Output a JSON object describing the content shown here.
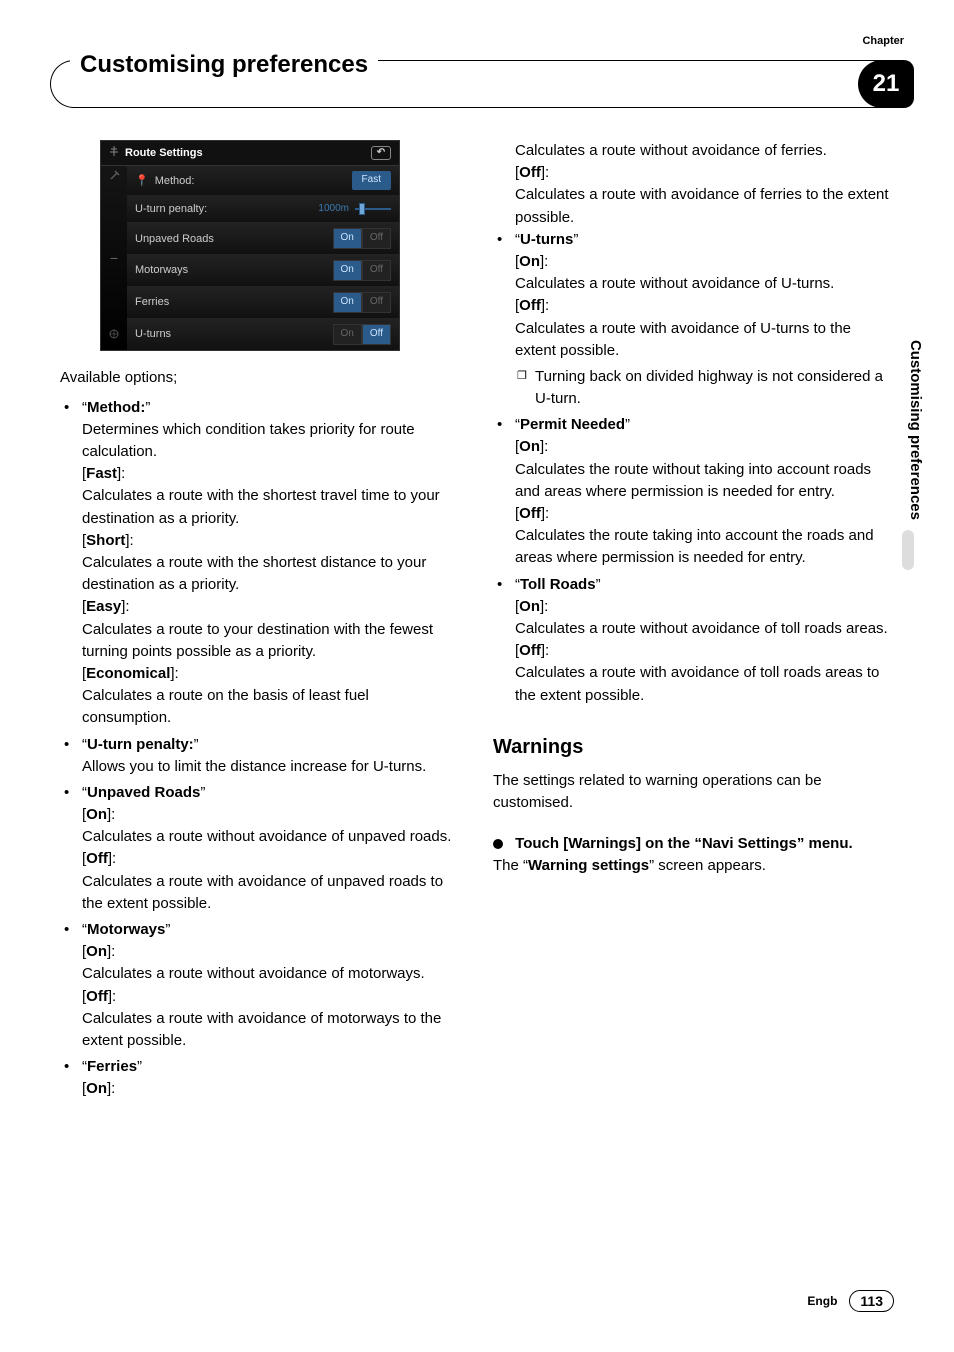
{
  "header": {
    "title": "Customising preferences",
    "chapter_label": "Chapter",
    "chapter_num": "21"
  },
  "side_tab": "Customising preferences",
  "footer": {
    "lang": "Engb",
    "page": "113"
  },
  "screenshot": {
    "title": "Route Settings",
    "rows": [
      {
        "label": "Method:",
        "type": "pill",
        "value": "Fast"
      },
      {
        "label": "U-turn penalty:",
        "type": "slider",
        "value": "1000m"
      },
      {
        "label": "Unpaved Roads",
        "type": "toggle",
        "on": "On",
        "off": "Off",
        "active": "on"
      },
      {
        "label": "Motorways",
        "type": "toggle",
        "on": "On",
        "off": "Off",
        "active": "on"
      },
      {
        "label": "Ferries",
        "type": "toggle",
        "on": "On",
        "off": "Off",
        "active": "on"
      },
      {
        "label": "U-turns",
        "type": "toggle",
        "on": "On",
        "off": "Off",
        "active": "off"
      }
    ]
  },
  "intro": "Available options;",
  "left_opts": [
    {
      "name": "Method:",
      "desc": "Determines which condition takes priority for route calculation.",
      "values": [
        {
          "label": "Fast",
          "desc": "Calculates a route with the shortest travel time to your destination as a priority."
        },
        {
          "label": "Short",
          "desc": "Calculates a route with the shortest distance to your destination as a priority."
        },
        {
          "label": "Easy",
          "desc": "Calculates a route to your destination with the fewest turning points possible as a priority."
        },
        {
          "label": "Economical",
          "desc": "Calculates a route on the basis of least fuel consumption."
        }
      ]
    },
    {
      "name": "U-turn penalty:",
      "desc": "Allows you to limit the distance increase for U-turns."
    },
    {
      "name": "Unpaved Roads",
      "values": [
        {
          "label": "On",
          "desc": "Calculates a route without avoidance of unpaved roads."
        },
        {
          "label": "Off",
          "desc": "Calculates a route with avoidance of unpaved roads to the extent possible."
        }
      ]
    },
    {
      "name": "Motorways",
      "values": [
        {
          "label": "On",
          "desc": "Calculates a route without avoidance of motorways."
        },
        {
          "label": "Off",
          "desc": "Calculates a route with avoidance of motorways to the extent possible."
        }
      ]
    },
    {
      "name": "Ferries",
      "values": [
        {
          "label": "On",
          "desc": ""
        }
      ]
    }
  ],
  "right_cont": "Calculates a route without avoidance of ferries.",
  "right_cont2_label": "Off",
  "right_cont2": "Calculates a route with avoidance of ferries to the extent possible.",
  "right_opts": [
    {
      "name": "U-turns",
      "values": [
        {
          "label": "On",
          "desc": "Calculates a route without avoidance of U-turns."
        },
        {
          "label": "Off",
          "desc": "Calculates a route with avoidance of U-turns to the extent possible."
        }
      ],
      "notes": [
        "Turning back on divided highway is not considered a U-turn."
      ]
    },
    {
      "name": "Permit Needed",
      "values": [
        {
          "label": "On",
          "desc": "Calculates the route without taking into account roads and areas where permission is needed for entry."
        },
        {
          "label": "Off",
          "desc": "Calculates the route taking into account the roads and areas where permission is needed for entry."
        }
      ]
    },
    {
      "name": "Toll Roads",
      "values": [
        {
          "label": "On",
          "desc": "Calculates a route without avoidance of toll roads areas."
        },
        {
          "label": "Off",
          "desc": "Calculates a route with avoidance of toll roads areas to the extent possible."
        }
      ]
    }
  ],
  "warnings": {
    "heading": "Warnings",
    "intro": "The settings related to warning operations can be customised.",
    "step": "Touch [Warnings] on the “Navi Settings” menu.",
    "result_pre": "The “",
    "result_bold": "Warning settings",
    "result_post": "” screen appears."
  }
}
